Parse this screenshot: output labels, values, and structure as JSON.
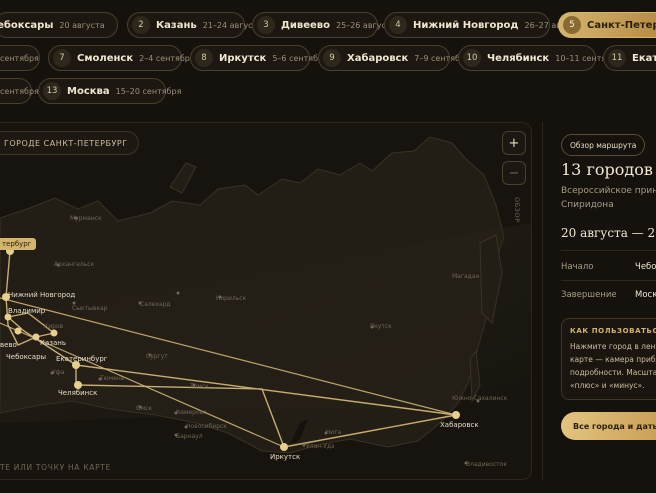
{
  "chips": [
    {
      "num": "",
      "name": "Чебоксары",
      "date": "20 августа"
    },
    {
      "num": "2",
      "name": "Казань",
      "date": "21–24 августа"
    },
    {
      "num": "3",
      "name": "Дивеево",
      "date": "25–26 августа"
    },
    {
      "num": "4",
      "name": "Нижний Новгород",
      "date": "26–27 августа"
    },
    {
      "num": "5",
      "name": "Санкт-Петербург",
      "date": "",
      "active": true
    },
    {
      "num": "",
      "name": "",
      "date": "сентября"
    },
    {
      "num": "7",
      "name": "Смоленск",
      "date": "2–4 сентября"
    },
    {
      "num": "8",
      "name": "Иркутск",
      "date": "5–6 сентября"
    },
    {
      "num": "9",
      "name": "Хабаровск",
      "date": "7–9 сентября"
    },
    {
      "num": "10",
      "name": "Челябинск",
      "date": "10–11 сентября"
    },
    {
      "num": "11",
      "name": "Екатер",
      "date": ""
    },
    {
      "num": "",
      "name": "",
      "date": "сентября"
    },
    {
      "num": "13",
      "name": "Москва",
      "date": "15–20 сентября"
    }
  ],
  "map": {
    "title": "ГОРОДЕ САНКТ-ПЕТЕРБУРГ",
    "hint": "ТЕ ИЛИ ТОЧКУ НА КАРТЕ",
    "zoom_in": "+",
    "zoom_out": "−",
    "overview_vertical": "ОБЗОР",
    "selected_pin": "тербург",
    "route_cities": [
      {
        "name": "Нижний Новгород"
      },
      {
        "name": "Владимир"
      },
      {
        "name": "Казань"
      },
      {
        "name": "Чебоксары"
      },
      {
        "name": "Екатеринбург"
      },
      {
        "name": "Челябинск"
      },
      {
        "name": "Иркутск"
      },
      {
        "name": "Хабаровск"
      },
      {
        "name": "вево"
      }
    ],
    "minor_cities": [
      "Мурманск",
      "Архангельск",
      "Киров",
      "Сыктывкар",
      "Салехард",
      "Норильск",
      "Якутск",
      "Сургут",
      "Томск",
      "Тюмень",
      "Уфа",
      "Омск",
      "Кемерово",
      "Новосибирск",
      "Барнаул",
      "Чита",
      "Улан-Удэ",
      "Магадан",
      "Южно-Сахалинск",
      "Владивосток"
    ]
  },
  "panel": {
    "overview_button": "Обзор маршрута",
    "title": "13 городов",
    "subtitle_1": "Всероссийское принесение",
    "subtitle_2": "Спиридона",
    "dates": "20 августа — 20",
    "start_label": "Начало",
    "start_value": "Чебо",
    "end_label": "Завершение",
    "end_value": "Моск",
    "howto_heading": "КАК ПОЛЬЗОВАТЬСЯ",
    "howto_1": "Нажмите город в ленте",
    "howto_2": "карте — камера прибл",
    "howto_3": "подробности. Масшта",
    "howto_4": "«плюс» и «минус».",
    "cta": "Все города и даты"
  },
  "colors": {
    "accent": "#d4b56e",
    "background": "#15120d",
    "route": "#d9bc7a"
  }
}
